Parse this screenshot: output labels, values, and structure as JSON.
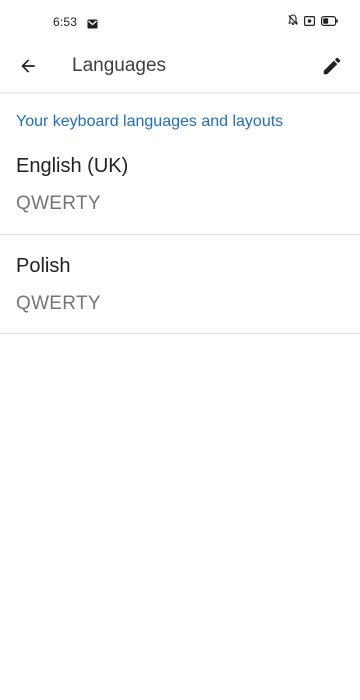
{
  "status_bar": {
    "time": "6:53",
    "notification_icon": "gmail-icon",
    "right_icons": [
      "silent-bell-icon",
      "screen-record-icon",
      "battery-icon"
    ]
  },
  "app_bar": {
    "title": "Languages",
    "back_icon": "arrow-back-icon",
    "edit_icon": "pencil-icon"
  },
  "section": {
    "header": "Your keyboard languages and layouts"
  },
  "languages": [
    {
      "name": "English (UK)",
      "layout": "QWERTY"
    },
    {
      "name": "Polish",
      "layout": "QWERTY"
    }
  ],
  "colors": {
    "accent": "#1e6fc0",
    "text_primary": "#202124",
    "text_secondary": "#757575",
    "divider": "#e0e0e0"
  }
}
